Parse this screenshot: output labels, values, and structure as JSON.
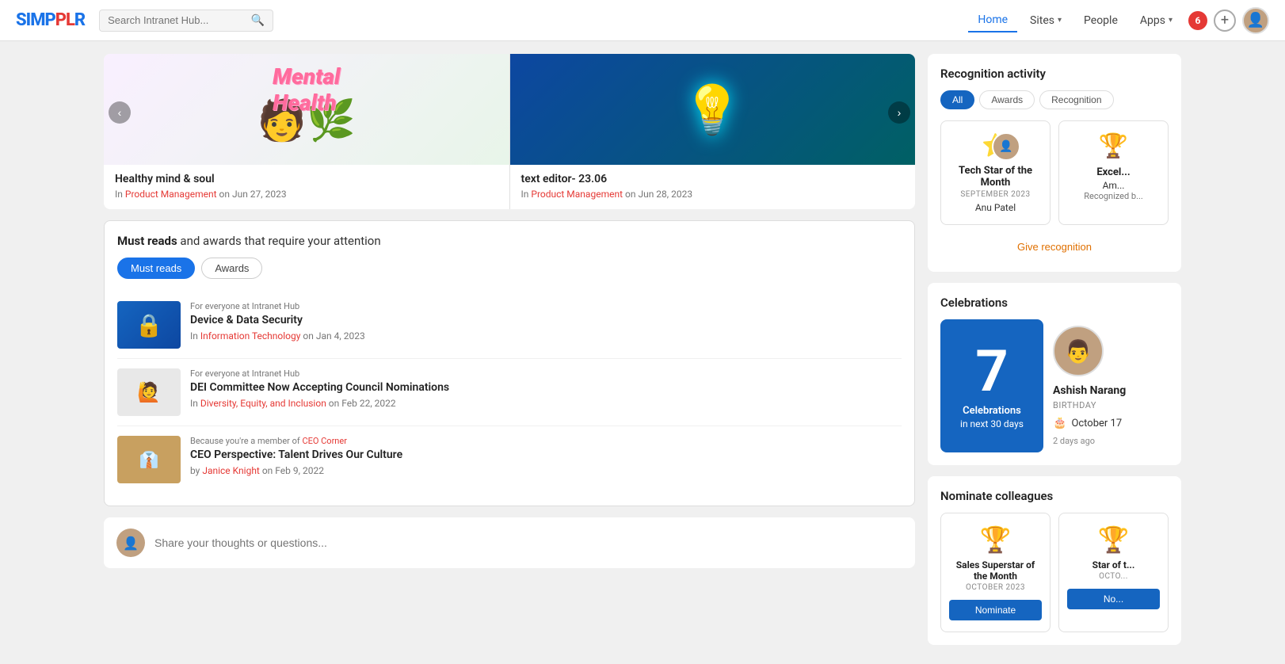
{
  "app": {
    "logo": "SIMPPLR",
    "logo_accent": "PL"
  },
  "navbar": {
    "search_placeholder": "Search Intranet Hub...",
    "nav_items": [
      {
        "label": "Home",
        "active": true
      },
      {
        "label": "Sites",
        "has_chevron": true
      },
      {
        "label": "People",
        "has_chevron": false
      },
      {
        "label": "Apps",
        "has_chevron": true
      }
    ],
    "notification_count": "6",
    "add_button_label": "+",
    "avatar_emoji": "👤"
  },
  "carousel": {
    "prev_label": "‹",
    "next_label": "›",
    "items": [
      {
        "title": "Healthy mind & soul",
        "category": "Product Management",
        "date": "Jun 27, 2023",
        "type": "mental-health"
      },
      {
        "title": "text editor- 23.06",
        "category": "Product Management",
        "date": "Jun 28, 2023",
        "type": "bulb"
      }
    ]
  },
  "must_reads": {
    "header_prefix": "Must reads",
    "header_suffix": "and awards that require your attention",
    "tabs": [
      {
        "label": "Must reads",
        "active": true
      },
      {
        "label": "Awards",
        "active": false
      }
    ],
    "items": [
      {
        "audience": "For everyone at Intranet Hub",
        "title": "Device & Data Security",
        "category": "Information Technology",
        "date": "Jan 4, 2023",
        "thumb_type": "security",
        "thumb_icon": "🔒"
      },
      {
        "audience": "For everyone at Intranet Hub",
        "title": "DEI Committee Now Accepting Council Nominations",
        "category": "Diversity, Equity, and Inclusion",
        "date": "Feb 22, 2022",
        "thumb_type": "dei",
        "thumb_icon": "🙋"
      },
      {
        "audience": "Because you're a member of CEO Corner",
        "audience_link": "CEO Corner",
        "title": "CEO Perspective: Talent Drives Our Culture",
        "author": "Janice Knight",
        "date": "Feb 9, 2022",
        "thumb_type": "ceo",
        "thumb_icon": "👔"
      }
    ]
  },
  "share_box": {
    "placeholder": "Share your thoughts or questions...",
    "avatar_emoji": "👤"
  },
  "recognition": {
    "title": "Recognition activity",
    "filters": [
      {
        "label": "All",
        "active": true
      },
      {
        "label": "Awards",
        "active": false
      },
      {
        "label": "Recognition",
        "active": false
      }
    ],
    "items": [
      {
        "badge": "⭐",
        "title": "Tech Star of the Month",
        "month": "SEPTEMBER 2023",
        "name": "Anu Patel",
        "icon": "🏆",
        "type": "stars"
      },
      {
        "badge": "🏆",
        "title": "Excel...",
        "month": "",
        "name": "Am...",
        "recognized_by": "Recognized b...",
        "icon": "🏆",
        "type": "trophy"
      }
    ],
    "give_recognition_label": "Give recognition"
  },
  "celebrations": {
    "title": "Celebrations",
    "count": "7",
    "subtitle": "Celebrations",
    "subtitle2": "in next 30 days",
    "person": {
      "name": "Ashish Narang",
      "type": "BIRTHDAY",
      "date": "October 17",
      "time_ago": "2 days ago",
      "avatar_emoji": "👨"
    }
  },
  "nominate": {
    "title": "Nominate colleagues",
    "items": [
      {
        "title": "Sales Superstar of the Month",
        "month": "OCTOBER 2023",
        "button_label": "Nominate"
      },
      {
        "title": "Star of t...",
        "month": "OCTO...",
        "button_label": "No..."
      }
    ]
  }
}
